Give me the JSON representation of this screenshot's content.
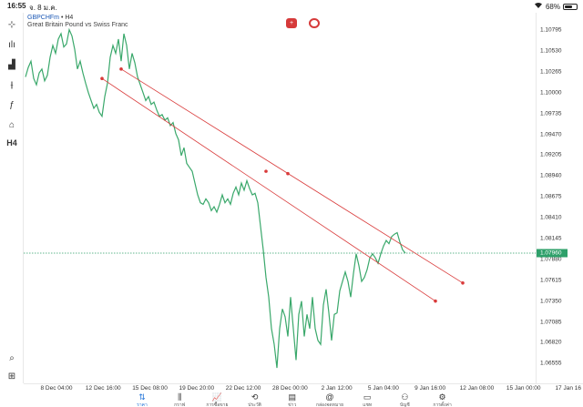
{
  "status_bar": {
    "time": "16:55",
    "date": "จ. 8 ม.ค.",
    "wifi_icon": "wifi-icon",
    "battery": "68%",
    "battery_level": 0.68
  },
  "chart": {
    "symbol": "GBPCHFm",
    "timeframe_suffix": " • H4",
    "description": "Great Britain Pound vs Swiss Franc",
    "line_color": "#3aa86b",
    "trend_color": "#d93a3a"
  },
  "left_toolbar": [
    {
      "name": "crosshair-icon",
      "glyph": "⊹"
    },
    {
      "name": "chart-type-icon",
      "glyph": "ılı"
    },
    {
      "name": "bar-chart-icon",
      "glyph": "▟"
    },
    {
      "name": "indicators-icon",
      "glyph": "⫲"
    },
    {
      "name": "function-icon",
      "glyph": "ƒ"
    },
    {
      "name": "shapes-icon",
      "glyph": "⌂"
    },
    {
      "name": "timeframe-button",
      "glyph": "H4"
    }
  ],
  "price_axis": {
    "labels": [
      "1.10795",
      "1.10530",
      "1.10265",
      "1.10000",
      "1.09735",
      "1.09470",
      "1.09205",
      "1.08940",
      "1.08675",
      "1.08410",
      "1.08145",
      "1.07880",
      "1.07615",
      "1.07350",
      "1.07085",
      "1.06820",
      "1.06555"
    ],
    "current": "1.07960"
  },
  "time_axis": {
    "labels": [
      "8 Dec 04:00",
      "12 Dec 16:00",
      "15 Dec 08:00",
      "19 Dec 20:00",
      "22 Dec 12:00",
      "28 Dec 00:00",
      "2 Jan 12:00",
      "5 Jan 04:00",
      "9 Jan 16:00",
      "12 Jan 08:00",
      "15 Jan 00:00",
      "17 Jan 16"
    ]
  },
  "bottom_nav": [
    {
      "name": "nav-quotes",
      "icon": "⇅",
      "label": "ราคา",
      "active": true
    },
    {
      "name": "nav-chart",
      "icon": "⫼",
      "label": "กราฟ",
      "active": false
    },
    {
      "name": "nav-trade",
      "icon": "📈",
      "label": "การซื้อขาย",
      "active": false
    },
    {
      "name": "nav-history",
      "icon": "⟲",
      "label": "ประวัติ",
      "active": false
    },
    {
      "name": "nav-news",
      "icon": "▤",
      "label": "ข่าว",
      "active": false
    },
    {
      "name": "nav-mailbox",
      "icon": "@",
      "label": "กล่องจดหมาย",
      "active": false
    },
    {
      "name": "nav-chat",
      "icon": "▭",
      "label": "แชท",
      "active": false
    },
    {
      "name": "nav-account",
      "icon": "⚇",
      "label": "บัญชี",
      "active": false
    },
    {
      "name": "nav-settings",
      "icon": "⚙",
      "label": "การตั้งค่า",
      "active": false
    }
  ],
  "chart_data": {
    "type": "line",
    "series": [
      {
        "values": [
          1.102,
          1.1032,
          1.104,
          1.1018,
          1.101,
          1.1025,
          1.103,
          1.1015,
          1.1022,
          1.1045,
          1.106,
          1.105,
          1.1068,
          1.1075,
          1.1058,
          1.1062,
          1.108,
          1.1072,
          1.1055,
          1.103,
          1.104,
          1.1025,
          1.1012,
          1.1,
          1.099,
          1.098,
          1.0985,
          1.0975,
          1.097,
          1.0995,
          1.1012,
          1.1045,
          1.106,
          1.105,
          1.1068,
          1.104,
          1.1075,
          1.106,
          1.103,
          1.105,
          1.1038,
          1.102,
          1.101,
          1.1,
          1.099,
          1.0995,
          1.0985,
          1.0988,
          1.0978,
          1.097,
          1.0972,
          1.0965,
          1.0968,
          1.0958,
          1.0962,
          1.0948,
          1.094,
          1.092,
          1.093,
          1.091,
          1.0905,
          1.09,
          1.0885,
          1.087,
          1.086,
          1.0858,
          1.0865,
          1.086,
          1.085,
          1.0855,
          1.0848,
          1.0858,
          1.087,
          1.086,
          1.0865,
          1.0858,
          1.0872,
          1.088,
          1.087,
          1.0885,
          1.0876,
          1.0888,
          1.0878,
          1.087,
          1.0872,
          1.086,
          1.083,
          1.08,
          1.0765,
          1.074,
          1.07,
          1.068,
          1.065,
          1.07,
          1.0725,
          1.0715,
          1.069,
          1.074,
          1.07,
          1.066,
          1.0718,
          1.0735,
          1.069,
          1.0718,
          1.07,
          1.074,
          1.07,
          1.0685,
          1.068,
          1.073,
          1.075,
          1.072,
          1.0685,
          1.0718,
          1.072,
          1.0748,
          1.076,
          1.0772,
          1.076,
          1.074,
          1.077,
          1.0795,
          1.078,
          1.076,
          1.0765,
          1.0775,
          1.079,
          1.0795,
          1.079,
          1.0783,
          1.0795,
          1.0805,
          1.0812,
          1.0808,
          1.0817,
          1.082,
          1.0822,
          1.081,
          1.08,
          1.0796
        ]
      }
    ],
    "x_ticks": [
      "8 Dec 04:00",
      "12 Dec 16:00",
      "15 Dec 08:00",
      "19 Dec 20:00",
      "22 Dec 12:00",
      "28 Dec 00:00",
      "2 Jan 12:00",
      "5 Jan 04:00",
      "9 Jan 16:00",
      "12 Jan 08:00",
      "15 Jan 00:00",
      "17 Jan 16"
    ],
    "ylim": [
      1.0642,
      1.109
    ],
    "current_price": 1.0796,
    "trend_lines": [
      {
        "start": {
          "index": 28,
          "price": 1.1018
        },
        "mid": {
          "index": 88,
          "price": 1.09
        },
        "end": {
          "index": 150,
          "price": 1.0735
        }
      },
      {
        "start": {
          "index": 35,
          "price": 1.103
        },
        "mid": {
          "index": 96,
          "price": 1.0897
        },
        "end": {
          "index": 160,
          "price": 1.0758
        }
      }
    ],
    "grid": false
  }
}
